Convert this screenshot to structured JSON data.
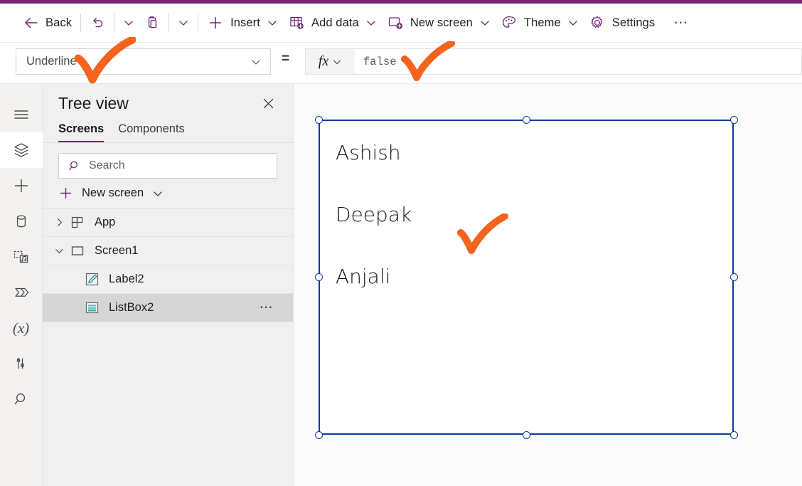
{
  "theme": {
    "accent_purple": "#742774",
    "annotation_orange": "#f4641e",
    "selection_blue": "#10399a",
    "tree_selected_bg": "#d6d6d6"
  },
  "toolbar": {
    "back_label": "Back",
    "undo_icon": "undo-icon",
    "undo_caret_icon": "chevron-down-icon",
    "paste_icon": "clipboard-icon",
    "paste_caret_icon": "chevron-down-icon",
    "insert_label": "Insert",
    "insert_icon": "plus-icon",
    "add_data_label": "Add data",
    "add_data_icon": "table-add-icon",
    "new_screen_label": "New screen",
    "new_screen_icon": "screen-add-icon",
    "theme_label": "Theme",
    "theme_icon": "palette-icon",
    "settings_label": "Settings",
    "settings_icon": "gear-icon",
    "overflow_label": "⋯",
    "chevron_icon": "chevron-down-icon"
  },
  "formula_bar": {
    "property_value": "Underline",
    "property_chevron_icon": "chevron-down-icon",
    "equals": "=",
    "fx_glyph": "fx",
    "fx_chevron_icon": "chevron-down-icon",
    "formula_value": "false"
  },
  "rail": {
    "items": [
      {
        "name": "hamburger-menu-icon",
        "active": false
      },
      {
        "name": "tree-view-layers-icon",
        "active": true
      },
      {
        "name": "insert-plus-icon",
        "active": false
      },
      {
        "name": "data-cylinder-icon",
        "active": false
      },
      {
        "name": "media-icon",
        "active": false
      },
      {
        "name": "power-automate-icon",
        "active": false
      },
      {
        "name": "variables-x-icon",
        "active": false
      },
      {
        "name": "advanced-tools-icon",
        "active": false
      },
      {
        "name": "search-icon",
        "active": false
      }
    ],
    "variables_glyph": "(x)"
  },
  "tree_view": {
    "title": "Tree view",
    "close_icon": "close-icon",
    "tabs": [
      {
        "label": "Screens",
        "active": true
      },
      {
        "label": "Components",
        "active": false
      }
    ],
    "search_placeholder": "Search",
    "search_value": "",
    "search_icon": "search-icon",
    "new_screen_label": "New screen",
    "new_screen_plus_icon": "plus-icon",
    "new_screen_chevron_icon": "chevron-down-icon",
    "rows": [
      {
        "label": "App",
        "icon": "app-grid-icon",
        "expander": "chevron-right-icon",
        "indent": 1,
        "selected": false,
        "has_overflow": false
      },
      {
        "label": "Screen1",
        "icon": "screen-rect-icon",
        "expander": "chevron-down-icon",
        "indent": 1,
        "selected": false,
        "has_overflow": false
      },
      {
        "label": "Label2",
        "icon": "label-pencil-icon",
        "expander": "",
        "indent": 2,
        "selected": false,
        "has_overflow": false
      },
      {
        "label": "ListBox2",
        "icon": "listbox-lines-icon",
        "expander": "",
        "indent": 2,
        "selected": true,
        "has_overflow": true,
        "overflow_label": "⋯"
      }
    ]
  },
  "canvas": {
    "control_name": "ListBox2",
    "selected": true,
    "items": [
      "Ashish",
      "Deepak",
      "Anjali"
    ],
    "underline": false
  },
  "annotations": [
    {
      "name": "checkmark-property-dropdown"
    },
    {
      "name": "checkmark-formula-value"
    },
    {
      "name": "checkmark-listbox-items"
    }
  ]
}
